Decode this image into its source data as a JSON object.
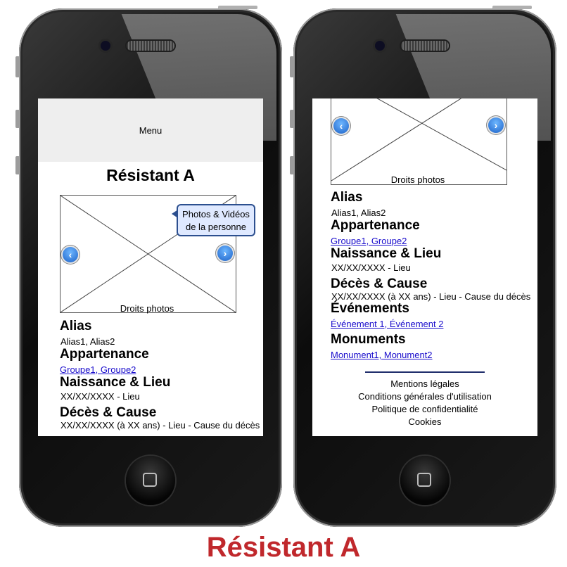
{
  "mockup_title": "Résistant A",
  "left_screen": {
    "menu_label": "Menu",
    "page_title": "Résistant A",
    "tooltip_lines": [
      "Photos & Vidéos",
      "de la personne"
    ],
    "photo_caption": "Droits photos",
    "sections": [
      {
        "heading": "Alias",
        "text": "Alias1, Alias2",
        "is_link": false
      },
      {
        "heading": "Appartenance",
        "text": "Groupe1, Groupe2",
        "is_link": true
      },
      {
        "heading": "Naissance & Lieu",
        "text": "XX/XX/XXXX - Lieu",
        "is_link": false
      },
      {
        "heading": "Décès & Cause",
        "text": "XX/XX/XXXX (à XX ans) - Lieu - Cause du décès",
        "is_link": false
      }
    ]
  },
  "right_screen": {
    "photo_caption": "Droits photos",
    "sections": [
      {
        "heading": "Alias",
        "text": "Alias1, Alias2",
        "is_link": false
      },
      {
        "heading": "Appartenance",
        "text": "Groupe1, Groupe2",
        "is_link": true
      },
      {
        "heading": "Naissance & Lieu",
        "text": "XX/XX/XXXX - Lieu",
        "is_link": false
      },
      {
        "heading": "Décès & Cause",
        "text": "XX/XX/XXXX (à XX ans) - Lieu - Cause du décès",
        "is_link": false
      },
      {
        "heading": "Événements",
        "text": "Événement 1, Événement 2",
        "is_link": true
      },
      {
        "heading": "Monuments",
        "text": "Monument1, Monument2",
        "is_link": true
      }
    ],
    "footer_links": [
      "Mentions légales",
      "Conditions générales d'utilisation",
      "Politique de confidentialité",
      "Cookies"
    ]
  },
  "icons": {
    "prev": "chevron-left-icon",
    "next": "chevron-right-icon",
    "home": "home-button-icon"
  },
  "colors": {
    "title_red": "#c0282c",
    "link_blue": "#1a0dcc",
    "tooltip_bg": "#dfe9ff",
    "tooltip_border": "#2c4f8f",
    "menu_bg": "#eeeeee"
  }
}
